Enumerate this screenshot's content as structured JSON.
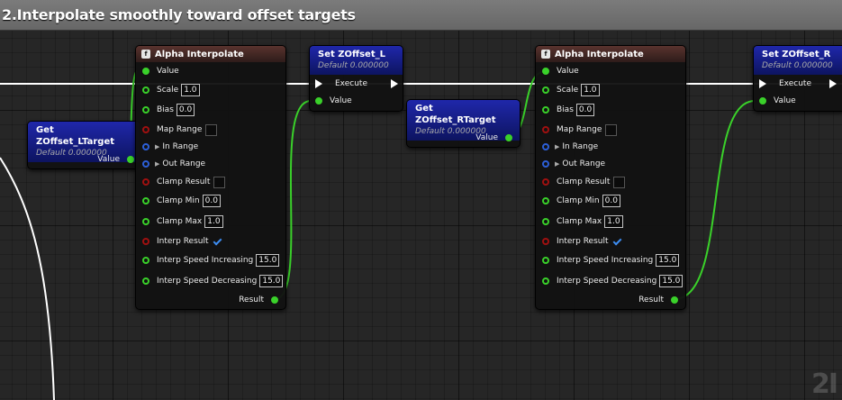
{
  "comment": {
    "title": "2.Interpolate smoothly toward offset targets"
  },
  "get_l": {
    "title": "Get ZOffset_LTarget",
    "subtitle": "Default 0.000000",
    "value_label": "Value"
  },
  "get_r": {
    "title": "Get ZOffset_RTarget",
    "subtitle": "Default 0.000000",
    "value_label": "Value"
  },
  "set_l": {
    "title": "Set ZOffset_L",
    "subtitle": "Default 0.000000",
    "execute_label": "Execute",
    "value_label": "Value"
  },
  "set_r": {
    "title": "Set ZOffset_R",
    "subtitle": "Default 0.000000",
    "execute_label": "Execute",
    "value_label": "Value"
  },
  "alpha_l": {
    "title": "Alpha Interpolate",
    "value": "Value",
    "scale": "Scale",
    "scale_val": "1.0",
    "bias": "Bias",
    "bias_val": "0.0",
    "map_range": "Map Range",
    "in_range": "In Range",
    "out_range": "Out Range",
    "clamp_result": "Clamp Result",
    "clamp_min": "Clamp Min",
    "clamp_min_val": "0.0",
    "clamp_max": "Clamp Max",
    "clamp_max_val": "1.0",
    "interp_result": "Interp Result",
    "speed_inc": "Interp Speed Increasing",
    "speed_inc_val": "15.0",
    "speed_dec": "Interp Speed Decreasing",
    "speed_dec_val": "15.0",
    "result": "Result"
  },
  "alpha_r": {
    "title": "Alpha Interpolate",
    "value": "Value",
    "scale": "Scale",
    "scale_val": "1.0",
    "bias": "Bias",
    "bias_val": "0.0",
    "map_range": "Map Range",
    "in_range": "In Range",
    "out_range": "Out Range",
    "clamp_result": "Clamp Result",
    "clamp_min": "Clamp Min",
    "clamp_min_val": "0.0",
    "clamp_max": "Clamp Max",
    "clamp_max_val": "1.0",
    "interp_result": "Interp Result",
    "speed_inc": "Interp Speed Increasing",
    "speed_inc_val": "15.0",
    "speed_dec": "Interp Speed Decreasing",
    "speed_dec_val": "15.0",
    "result": "Result"
  },
  "watermark": "2I",
  "colors": {
    "float_pin": "#3ad12a",
    "bool_pin": "#a01010",
    "struct_pin": "#2c5fd8",
    "exec_wire": "#ffffff",
    "var_header": "#1f27aa",
    "func_header": "#59332e"
  }
}
